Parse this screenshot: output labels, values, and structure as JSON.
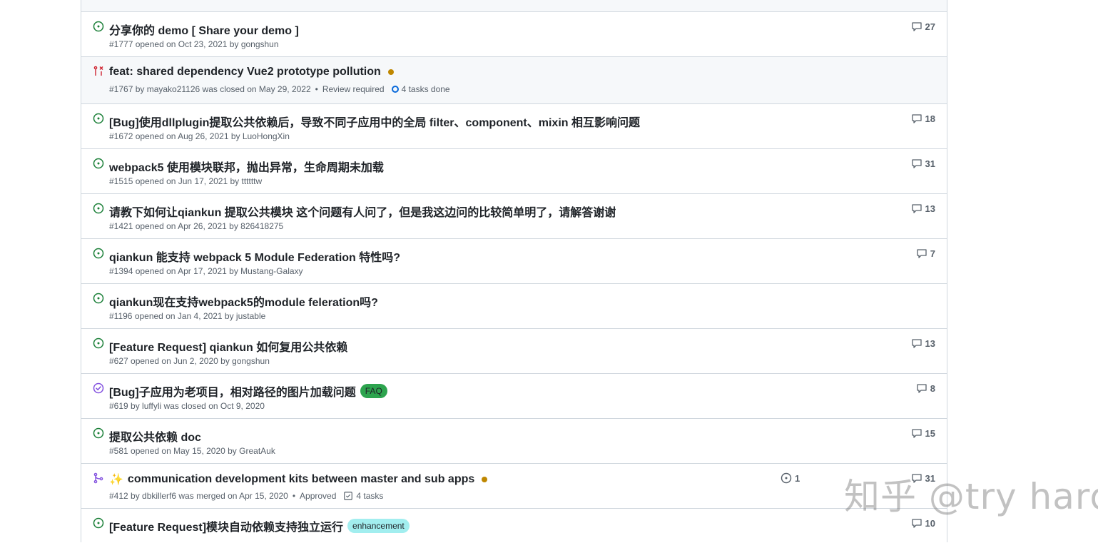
{
  "colors": {
    "open": "#1a7f37",
    "closed": "#8250df",
    "pr_closed": "#cf222e",
    "merged": "#8250df",
    "faq": "#2da44e",
    "enhancement": "#a2eeef"
  },
  "rows": [
    {
      "title": "分享你的 demo [ Share your demo ]",
      "meta": "#1777 opened on Oct 23, 2021 by gongshun",
      "comments": "27",
      "icon": "issue-open-icon"
    },
    {
      "title": "feat: shared dependency Vue2 prototype pollution",
      "meta": "#1767 by mayako21126 was closed on May 29, 2022",
      "review": "Review required",
      "tasks": "4 tasks done",
      "icon": "pr-closed-icon"
    },
    {
      "title": "[Bug]使用dllplugin提取公共依赖后，导致不同子应用中的全局 filter、component、mixin 相互影响问题",
      "meta": "#1672 opened on Aug 26, 2021 by LuoHongXin",
      "comments": "18",
      "icon": "issue-open-icon"
    },
    {
      "title": "webpack5 使用模块联邦，抛出异常，生命周期未加载",
      "meta": "#1515 opened on Jun 17, 2021 by ttttttw",
      "comments": "31",
      "icon": "issue-open-icon"
    },
    {
      "title": "请教下如何让qiankun 提取公共模块 这个问题有人问了，但是我这边问的比较简单明了，请解答谢谢",
      "meta": "#1421 opened on Apr 26, 2021 by 826418275",
      "comments": "13",
      "icon": "issue-open-icon"
    },
    {
      "title": "qiankun 能支持 webpack 5 Module Federation 特性吗?",
      "meta": "#1394 opened on Apr 17, 2021 by Mustang-Galaxy",
      "comments": "7",
      "icon": "issue-open-icon"
    },
    {
      "title": "qiankun现在支持webpack5的module feleration吗?",
      "meta": "#1196 opened on Jan 4, 2021 by justable",
      "comments": "",
      "icon": "issue-open-icon"
    },
    {
      "title": "[Feature Request] qiankun 如何复用公共依赖",
      "meta": "#627 opened on Jun 2, 2020 by gongshun",
      "comments": "13",
      "icon": "issue-open-icon"
    },
    {
      "title": "[Bug]子应用为老项目，相对路径的图片加载问题",
      "label": "FAQ",
      "meta": "#619 by luffyli was closed on Oct 9, 2020",
      "comments": "8",
      "icon": "issue-closed-icon"
    },
    {
      "title": "提取公共依赖 doc",
      "meta": "#581 opened on May 15, 2020 by GreatAuk",
      "comments": "15",
      "icon": "issue-open-icon"
    },
    {
      "title": "communication development kits between master and sub apps",
      "sparkle": "✨",
      "meta": "#412 by dbkillerf6 was merged on Apr 15, 2020",
      "review": "Approved",
      "tasks": "4 tasks",
      "linked": "1",
      "comments": "31",
      "icon": "pr-merged-icon"
    },
    {
      "title": "[Feature Request]模块自动依赖支持独立运行",
      "label": "enhancement",
      "meta": "",
      "comments": "10",
      "icon": "issue-open-icon"
    }
  ],
  "watermark": "知乎 @try hard"
}
